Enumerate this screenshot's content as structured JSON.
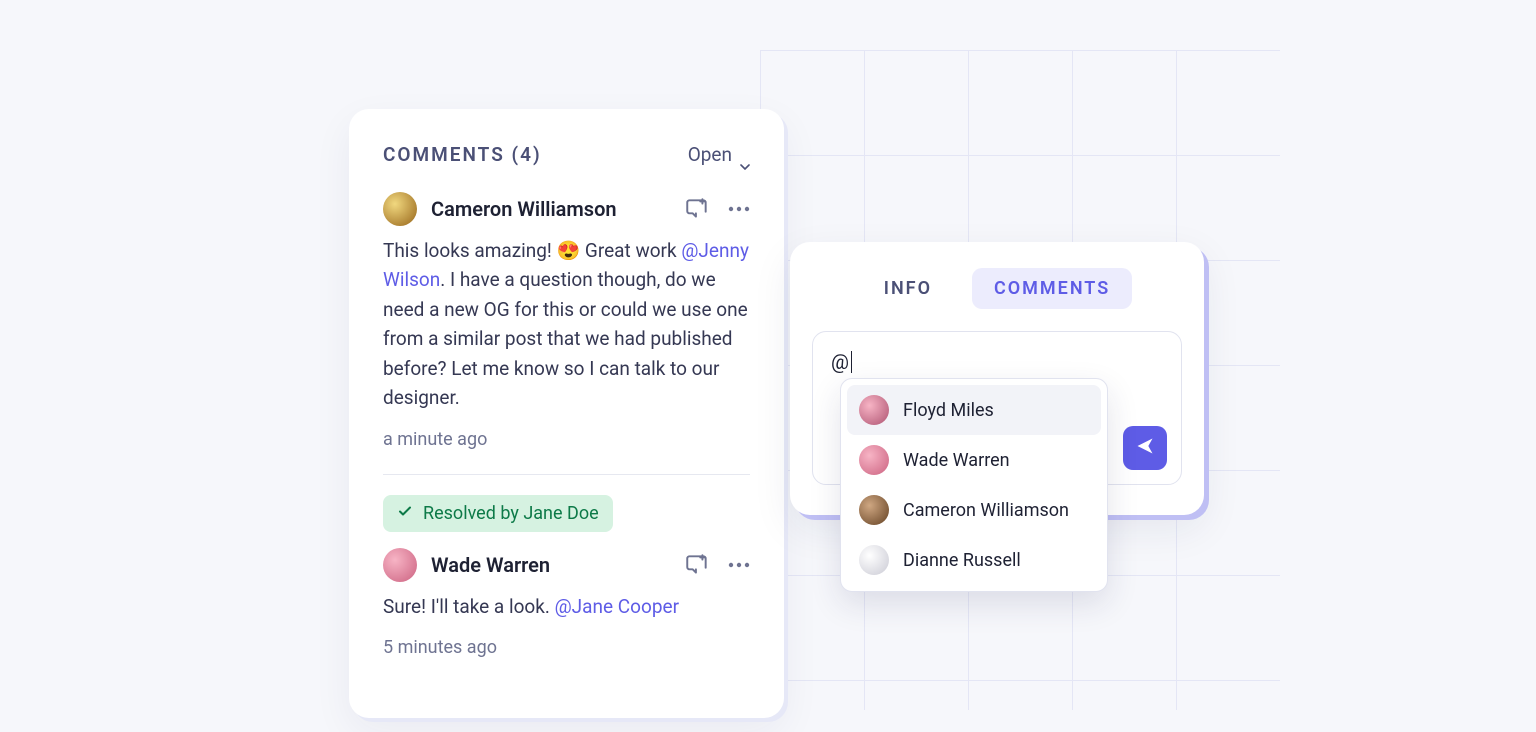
{
  "commentsPanel": {
    "title": "COMMENTS (4)",
    "filterLabel": "Open",
    "items": [
      {
        "author": "Cameron Williamson",
        "body_pre": "This looks amazing! 😍 Great work ",
        "mention": "@Jenny Wilson",
        "body_post": ". I have a question though, do we need a new OG for this or could we use one from a similar post that we had published before? Let me know so I can talk to our designer.",
        "time": "a minute ago",
        "resolved": null
      },
      {
        "author": "Wade Warren",
        "body_pre": "Sure! I'll take a look. ",
        "mention": "@Jane Cooper",
        "body_post": "",
        "time": "5 minutes ago",
        "resolved": "Resolved by Jane Doe"
      }
    ]
  },
  "compose": {
    "tabs": {
      "info": "INFO",
      "comments": "COMMENTS"
    },
    "inputValue": "@"
  },
  "mentionDropdown": {
    "items": [
      {
        "name": "Floyd Miles"
      },
      {
        "name": "Wade Warren"
      },
      {
        "name": "Cameron Williamson"
      },
      {
        "name": "Dianne Russell"
      }
    ]
  }
}
